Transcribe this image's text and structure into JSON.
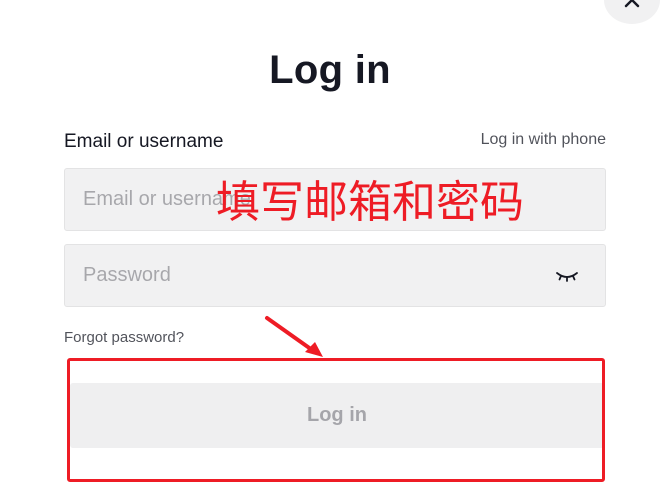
{
  "header": {
    "title": "Log in",
    "close_icon": "close-icon"
  },
  "form": {
    "email_label": "Email or username",
    "phone_link": "Log in with phone",
    "email_placeholder": "Email or username",
    "email_value": "",
    "password_placeholder": "Password",
    "password_value": "",
    "password_toggle_icon": "eye-closed-icon",
    "forgot_password": "Forgot password?",
    "submit_label": "Log in",
    "submit_enabled": false
  },
  "annotations": {
    "instruction": "填写邮箱和密码",
    "color": "#ee1c25",
    "arrow_icon": "arrow-icon"
  },
  "colors": {
    "text": "#161823",
    "input_bg": "#f1f1f2",
    "button_disabled_bg": "#efeff0"
  }
}
